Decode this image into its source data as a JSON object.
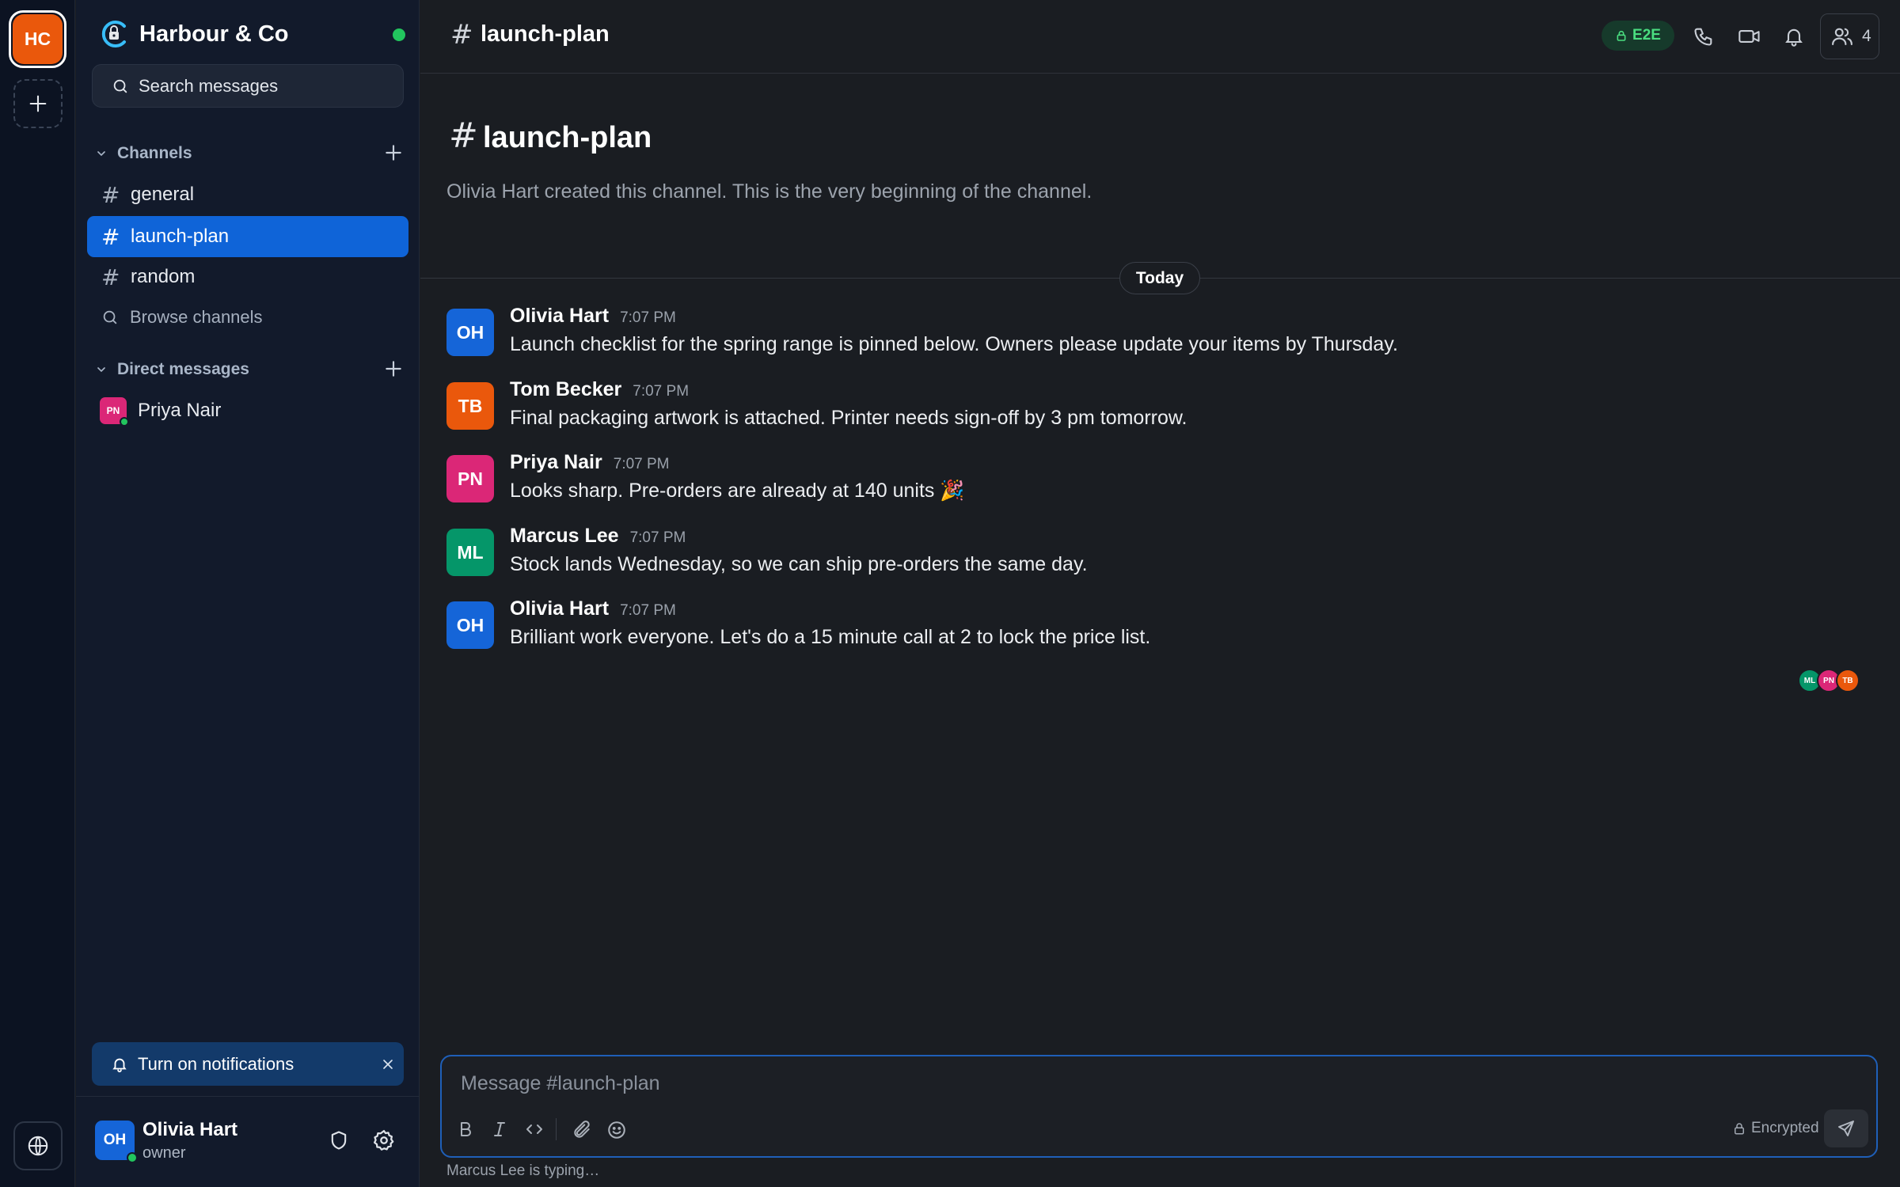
{
  "workspace": {
    "initials": "HC",
    "name": "Harbour & Co"
  },
  "search": {
    "label": "Search messages"
  },
  "sidebar": {
    "channels_label": "Channels",
    "channels": [
      {
        "name": "general",
        "active": false
      },
      {
        "name": "launch-plan",
        "active": true
      },
      {
        "name": "random",
        "active": false
      }
    ],
    "browse_label": "Browse channels",
    "dm_label": "Direct messages",
    "dms": [
      {
        "initials": "PN",
        "name": "Priya Nair",
        "color": "#db2777"
      }
    ],
    "notification_banner": "Turn on notifications"
  },
  "current_user": {
    "initials": "OH",
    "name": "Olivia Hart",
    "role": "owner"
  },
  "channel": {
    "name": "launch-plan",
    "e2e_badge": "E2E",
    "member_count": "4",
    "intro_title": "launch-plan",
    "intro_text": "Olivia Hart created this channel. This is the very beginning of the channel."
  },
  "day_divider": "Today",
  "messages": [
    {
      "initials": "OH",
      "author": "Olivia Hart",
      "time": "7:07 PM",
      "color": "#1565d8",
      "body": "Launch checklist for the spring range is pinned below. Owners please update your items by Thursday."
    },
    {
      "initials": "TB",
      "author": "Tom Becker",
      "time": "7:07 PM",
      "color": "#ea580c",
      "body": "Final packaging artwork is attached. Printer needs sign-off by 3 pm tomorrow."
    },
    {
      "initials": "PN",
      "author": "Priya Nair",
      "time": "7:07 PM",
      "color": "#db2777",
      "body": "Looks sharp. Pre-orders are already at 140 units 🎉"
    },
    {
      "initials": "ML",
      "author": "Marcus Lee",
      "time": "7:07 PM",
      "color": "#059669",
      "body": "Stock lands Wednesday, so we can ship pre-orders the same day."
    },
    {
      "initials": "OH",
      "author": "Olivia Hart",
      "time": "7:07 PM",
      "color": "#1565d8",
      "body": "Brilliant work everyone. Let's do a 15 minute call at 2 to lock the price list."
    }
  ],
  "read_receipts": [
    {
      "initials": "ML",
      "color": "#059669"
    },
    {
      "initials": "PN",
      "color": "#db2777"
    },
    {
      "initials": "TB",
      "color": "#ea580c"
    }
  ],
  "composer": {
    "placeholder": "Message #launch-plan",
    "encrypted_label": "Encrypted"
  },
  "typing_indicator": "Marcus Lee is typing…",
  "colors": {
    "accent": "#0f64d8",
    "online": "#22c55e",
    "e2e_text": "#4ade80"
  }
}
